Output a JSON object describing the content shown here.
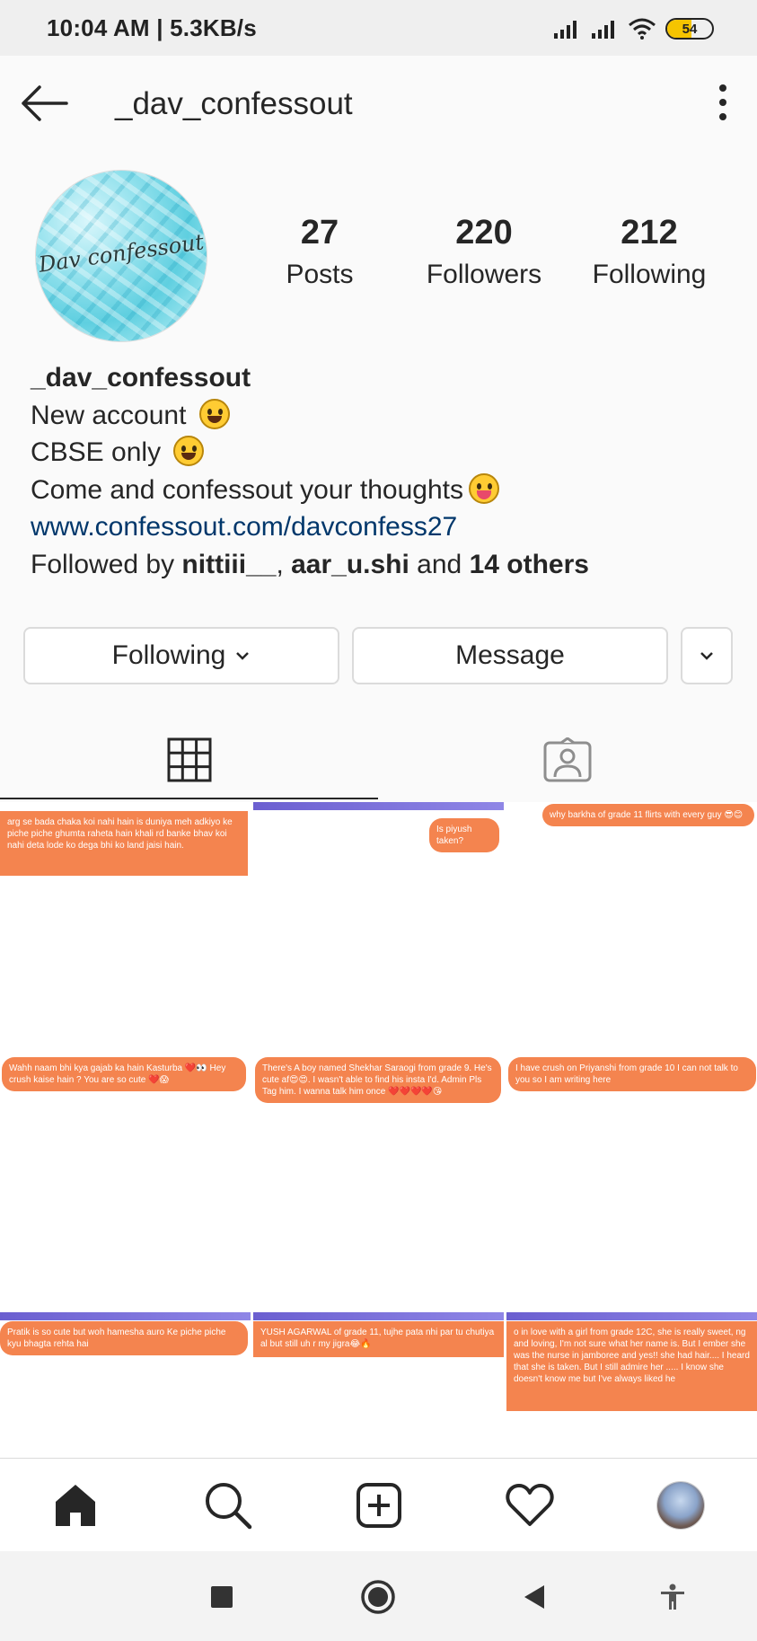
{
  "status_bar": {
    "time": "10:04 AM | 5.3KB/s",
    "battery": "54"
  },
  "header": {
    "title": "_dav_confessout"
  },
  "profile": {
    "avatar_text": "Dav confessout",
    "stats": {
      "posts": {
        "value": "27",
        "label": "Posts"
      },
      "followers": {
        "value": "220",
        "label": "Followers"
      },
      "following": {
        "value": "212",
        "label": "Following"
      }
    },
    "bio": {
      "name": "_dav_confessout",
      "line1": "New account",
      "line2": "CBSE only",
      "line3": "Come and confessout your thoughts",
      "link": "www.confessout.com/davconfess27",
      "followed_by_prefix": "Followed by ",
      "followed_user1": "nittiii__",
      "followed_sep": ", ",
      "followed_user2": "aar_u.shi",
      "followed_and": " and ",
      "followed_others": "14 others"
    }
  },
  "actions": {
    "following_label": "Following",
    "message_label": "Message"
  },
  "tabs": {
    "grid_icon": "grid-icon",
    "tagged_icon": "tagged-person-icon"
  },
  "posts": [
    {
      "text": "arg se bada chaka koi nahi hain is duniya meh adkiyo ke piche piche ghumta raheta hain khali rd banke bhav koi nahi deta lode ko dega bhi ko land jaisi hain."
    },
    {
      "text": "Is piyush taken?"
    },
    {
      "text": "why barkha of grade 11 flirts with every guy 😎😊"
    },
    {
      "text": "Wahh naam bhi kya gajab ka hain Kasturba ❤️👀 Hey crush kaise hain ? You are so cute ❤️😱"
    },
    {
      "text": "There's A boy named Shekhar Saraogi from grade 9. He's cute af😍😍. I wasn't able to find his insta I'd. Admin Pls Tag him. I wanna talk him once ❤️❤️❤️❤️😘"
    },
    {
      "text": "I have crush on Priyanshi from grade 10 I can not talk to you so I am writing here"
    },
    {
      "text": "Pratik is so cute but woh hamesha auro Ke piche piche kyu bhagta rehta hai"
    },
    {
      "text": "YUSH AGARWAL of grade 11, tujhe pata nhi par tu chutiya al but still uh r my jigra😂🔥"
    },
    {
      "text": "o in love with a girl from grade 12C, she is really sweet, ng and loving, I'm not sure what her name is. But I ember she was the nurse in jamboree and yes!! she had hair.... I heard that she is taken. But I still admire her ..... I know she doesn't know me but I've always liked he"
    }
  ],
  "bottom_nav": [
    "home-icon",
    "search-icon",
    "add-post-icon",
    "activity-heart-icon",
    "profile-avatar"
  ],
  "colors": {
    "bubble": "#f4844f",
    "accent_bar": "#6b5fd0",
    "link": "#00376b"
  }
}
